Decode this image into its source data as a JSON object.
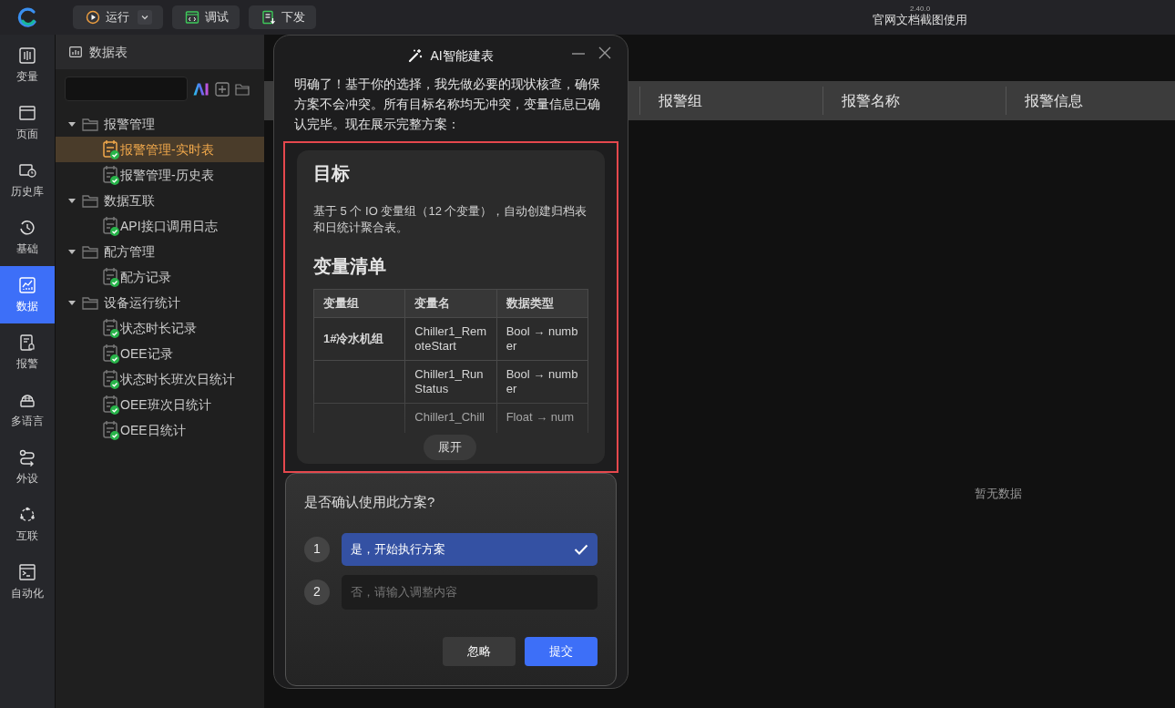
{
  "toolbar": {
    "buttons": [
      {
        "label": "运行",
        "kind": "run",
        "dropdown": true
      },
      {
        "label": "调试",
        "kind": "debug",
        "dropdown": false
      },
      {
        "label": "下发",
        "kind": "deploy",
        "dropdown": false
      }
    ],
    "version": "2.40.0",
    "title": "官网文档截图使用"
  },
  "rail": [
    {
      "label": "变量",
      "kind": "variable",
      "selected": false
    },
    {
      "label": "页面",
      "kind": "page",
      "selected": false
    },
    {
      "label": "历史库",
      "kind": "history",
      "selected": false
    },
    {
      "label": "基础",
      "kind": "basic",
      "selected": false
    },
    {
      "label": "数据",
      "kind": "data",
      "selected": true
    },
    {
      "label": "报警",
      "kind": "alarm",
      "selected": false
    },
    {
      "label": "多语言",
      "kind": "language",
      "selected": false
    },
    {
      "label": "外设",
      "kind": "device",
      "selected": false
    },
    {
      "label": "互联",
      "kind": "link",
      "selected": false
    },
    {
      "label": "自动化",
      "kind": "automation",
      "selected": false
    }
  ],
  "data_panel": {
    "title": "数据表",
    "tree": [
      {
        "label": "报警管理",
        "expanded": true,
        "children": [
          {
            "label": "报警管理-实时表",
            "selected": true
          },
          {
            "label": "报警管理-历史表",
            "selected": false
          }
        ]
      },
      {
        "label": "数据互联",
        "expanded": true,
        "children": [
          {
            "label": "API接口调用日志",
            "selected": false
          }
        ]
      },
      {
        "label": "配方管理",
        "expanded": true,
        "children": [
          {
            "label": "配方记录",
            "selected": false
          }
        ]
      },
      {
        "label": "设备运行统计",
        "expanded": true,
        "children": [
          {
            "label": "状态时长记录",
            "selected": false
          },
          {
            "label": "OEE记录",
            "selected": false
          },
          {
            "label": "状态时长班次日统计",
            "selected": false
          },
          {
            "label": "OEE班次日统计",
            "selected": false
          },
          {
            "label": "OEE日统计",
            "selected": false
          }
        ]
      }
    ]
  },
  "main": {
    "columns": [
      "报警组",
      "报警名称",
      "报警信息"
    ],
    "empty_text": "暂无数据"
  },
  "dialog": {
    "title": "AI智能建表",
    "message": "明确了！基于你的选择，我先做必要的现状核查，确保方案不会冲突。所有目标名称均无冲突，变量信息已确认完毕。现在展示完整方案：",
    "plan": {
      "heading": "目标",
      "text": "基于 5 个 IO 变量组（12 个变量），自动创建归档表和日统计聚合表。",
      "section": "变量清单",
      "table": {
        "columns": [
          "变量组",
          "变量名",
          "数据类型"
        ],
        "rows": [
          [
            "1#冷水机组",
            "Chiller1_RemoteStart",
            "Bool → number"
          ],
          [
            "",
            "Chiller1_RunStatus",
            "Bool → number"
          ],
          [
            "",
            "Chiller1_Chill",
            "Float → num"
          ]
        ]
      },
      "expand_button": "展开"
    },
    "confirm": {
      "question": "是否确认使用此方案?",
      "options": [
        {
          "number": "1",
          "kind": "choice",
          "label": "是，开始执行方案",
          "selected": true
        },
        {
          "number": "2",
          "kind": "input",
          "placeholder": "否，请输入调整内容",
          "selected": false
        }
      ],
      "buttons": [
        {
          "label": "忽略",
          "kind": "secondary"
        },
        {
          "label": "提交",
          "kind": "primary"
        }
      ]
    }
  }
}
